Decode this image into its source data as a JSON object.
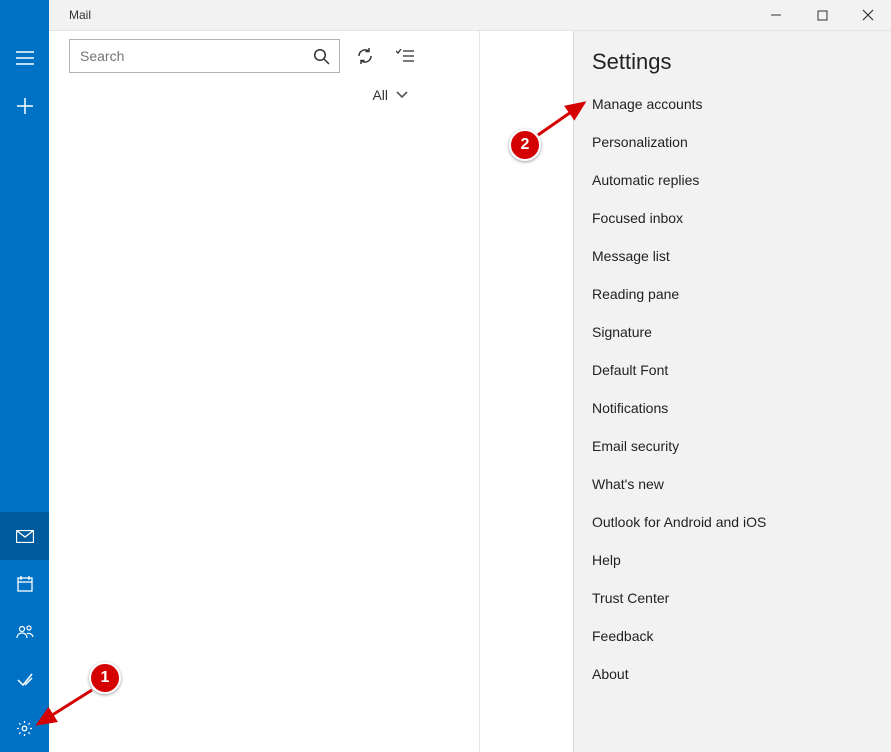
{
  "titlebar": {
    "title": "Mail"
  },
  "search": {
    "placeholder": "Search"
  },
  "filter": {
    "label": "All"
  },
  "settings": {
    "title": "Settings",
    "items": [
      "Manage accounts",
      "Personalization",
      "Automatic replies",
      "Focused inbox",
      "Message list",
      "Reading pane",
      "Signature",
      "Default Font",
      "Notifications",
      "Email security",
      "What's new",
      "Outlook for Android and iOS",
      "Help",
      "Trust Center",
      "Feedback",
      "About"
    ]
  },
  "annotations": {
    "marker1": "1",
    "marker2": "2"
  }
}
